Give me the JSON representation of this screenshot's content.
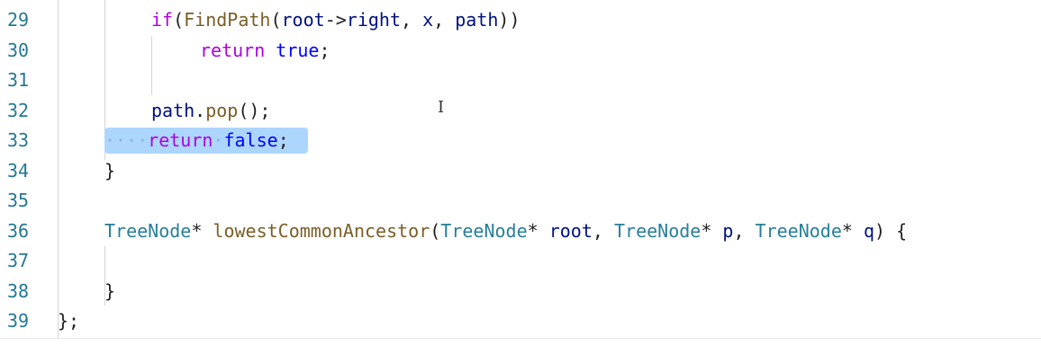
{
  "editor": {
    "lines": [
      {
        "num": "29",
        "tokens": [
          {
            "t": "if",
            "c": "kw-ctrl"
          },
          {
            "t": "(",
            "c": "punc"
          },
          {
            "t": "FindPath",
            "c": "fn"
          },
          {
            "t": "(",
            "c": "punc"
          },
          {
            "t": "root",
            "c": "var"
          },
          {
            "t": "->",
            "c": "punc"
          },
          {
            "t": "right",
            "c": "var"
          },
          {
            "t": ", ",
            "c": "punc"
          },
          {
            "t": "x",
            "c": "var"
          },
          {
            "t": ", ",
            "c": "punc"
          },
          {
            "t": "path",
            "c": "var"
          },
          {
            "t": "))",
            "c": "punc"
          }
        ]
      },
      {
        "num": "30",
        "tokens": [
          {
            "t": "return",
            "c": "kw-ctrl"
          },
          {
            "t": " ",
            "c": "punc"
          },
          {
            "t": "true",
            "c": "kw"
          },
          {
            "t": ";",
            "c": "punc"
          }
        ]
      },
      {
        "num": "31",
        "tokens": []
      },
      {
        "num": "32",
        "tokens": [
          {
            "t": "path",
            "c": "var"
          },
          {
            "t": ".",
            "c": "punc"
          },
          {
            "t": "pop",
            "c": "fn"
          },
          {
            "t": "();",
            "c": "punc"
          }
        ]
      },
      {
        "num": "33",
        "tokens": [
          {
            "t": "····",
            "c": "ws-dots"
          },
          {
            "t": "return",
            "c": "kw-ctrl"
          },
          {
            "t": "·",
            "c": "ws-dots"
          },
          {
            "t": "false",
            "c": "kw"
          },
          {
            "t": ";",
            "c": "punc"
          }
        ]
      },
      {
        "num": "34",
        "tokens": [
          {
            "t": "}",
            "c": "punc"
          }
        ]
      },
      {
        "num": "35",
        "tokens": []
      },
      {
        "num": "36",
        "tokens": [
          {
            "t": "TreeNode",
            "c": "type"
          },
          {
            "t": "* ",
            "c": "punc"
          },
          {
            "t": "lowestCommonAncestor",
            "c": "fn"
          },
          {
            "t": "(",
            "c": "punc"
          },
          {
            "t": "TreeNode",
            "c": "type"
          },
          {
            "t": "* ",
            "c": "punc"
          },
          {
            "t": "root",
            "c": "var"
          },
          {
            "t": ", ",
            "c": "punc"
          },
          {
            "t": "TreeNode",
            "c": "type"
          },
          {
            "t": "* ",
            "c": "punc"
          },
          {
            "t": "p",
            "c": "var"
          },
          {
            "t": ", ",
            "c": "punc"
          },
          {
            "t": "TreeNode",
            "c": "type"
          },
          {
            "t": "* ",
            "c": "punc"
          },
          {
            "t": "q",
            "c": "var"
          },
          {
            "t": ") {",
            "c": "punc"
          }
        ]
      },
      {
        "num": "37",
        "tokens": []
      },
      {
        "num": "38",
        "tokens": [
          {
            "t": "}",
            "c": "punc"
          }
        ]
      },
      {
        "num": "39",
        "tokens": [
          {
            "t": "};",
            "c": "punc"
          }
        ]
      }
    ],
    "cursor_glyph": "I"
  },
  "colors": {
    "line_number": "#237893",
    "control_keyword": "#af00db",
    "keyword": "#0000ff",
    "function": "#795e26",
    "type": "#267f99",
    "variable": "#001080",
    "selection": "#add6ff"
  }
}
